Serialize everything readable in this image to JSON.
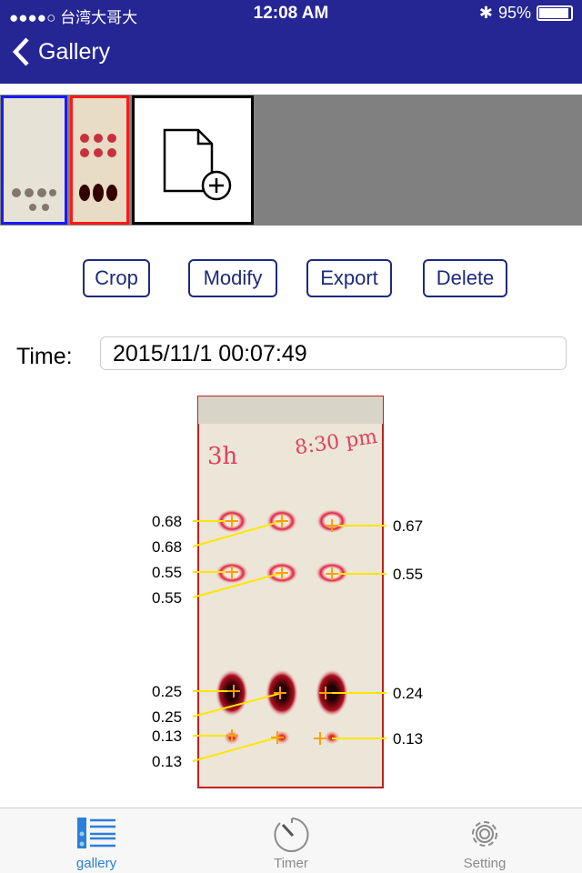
{
  "status_bar": {
    "carrier": "●●●●○ 台湾大哥大",
    "time": "12:08 AM",
    "battery": "95%",
    "battery_level": 0.95
  },
  "nav": {
    "back_label": "Gallery"
  },
  "thumbnails": [
    {
      "border": "#1a1aff",
      "selected": false
    },
    {
      "border": "#ff1a1a",
      "selected": true
    }
  ],
  "add_icon": "file-add-icon",
  "actions": {
    "crop": "Crop",
    "modify": "Modify",
    "export": "Export",
    "delete": "Delete"
  },
  "time": {
    "label": "Time:",
    "value": "2015/11/1 00:07:49"
  },
  "plate": {
    "handwriting": [
      "3h",
      "8:30 pm"
    ],
    "left_labels": [
      "0.68",
      "0.68",
      "0.55",
      "0.55",
      "0.25",
      "0.25",
      "0.13",
      "0.13"
    ],
    "right_labels": [
      "0.67",
      "0.55",
      "0.24",
      "0.13"
    ]
  },
  "tabbar": {
    "items": [
      {
        "label": "gallery",
        "active": true
      },
      {
        "label": "Timer",
        "active": false
      },
      {
        "label": "Setting",
        "active": false
      }
    ]
  },
  "colors": {
    "nav": "#252594",
    "accent": "#2a7fd8",
    "marker": "#ffe600"
  }
}
